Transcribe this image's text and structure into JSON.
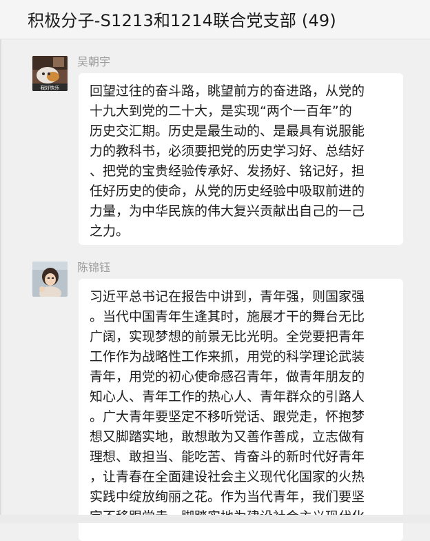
{
  "chat": {
    "title": "积极分子-S1213和1214联合党支部 (49)"
  },
  "messages": [
    {
      "sender": "吴朝宇",
      "avatar_caption": "我好快乐",
      "lines": [
        "回望过往的奋斗路，眺望前方的奋进路，从党的",
        "十九大到党的二十大，是实现“两个一百年”的",
        "历史交汇期。历史是最生动的、是最具有说服能",
        "力的教科书，必须要把党的历史学习好、总结好",
        "、把党的宝贵经验传承好、发扬好、铭记好，担",
        "任好历史的使命，从党的历史经验中吸取前进的",
        "力量，为中华民族的伟大复兴贡献出自己的一己",
        "之力。"
      ]
    },
    {
      "sender": "陈锦钰",
      "lines": [
        "习近平总书记在报告中讲到，青年强，则国家强",
        "。当代中国青年生逢其时，施展才干的舞台无比",
        "广阔，实现梦想的前景无比光明。全党要把青年",
        "工作作为战略性工作来抓，用党的科学理论武装",
        "青年，用党的初心使命感召青年，做青年朋友的",
        "知心人、青年工作的热心人、青年群众的引路人",
        "。广大青年要坚定不移听党话、跟党走，怀抱梦",
        "想又脚踏实地，敢想敢为又善作善成，立志做有",
        "理想、敢担当、能吃苦、肯奋斗的新时代好青年",
        "，让青春在全面建设社会主义现代化国家的火热",
        "实践中绽放绚丽之花。作为当代青年，我们要坚",
        "定不移跟党走，脚踏实地为建设社会主义现代化"
      ]
    }
  ]
}
